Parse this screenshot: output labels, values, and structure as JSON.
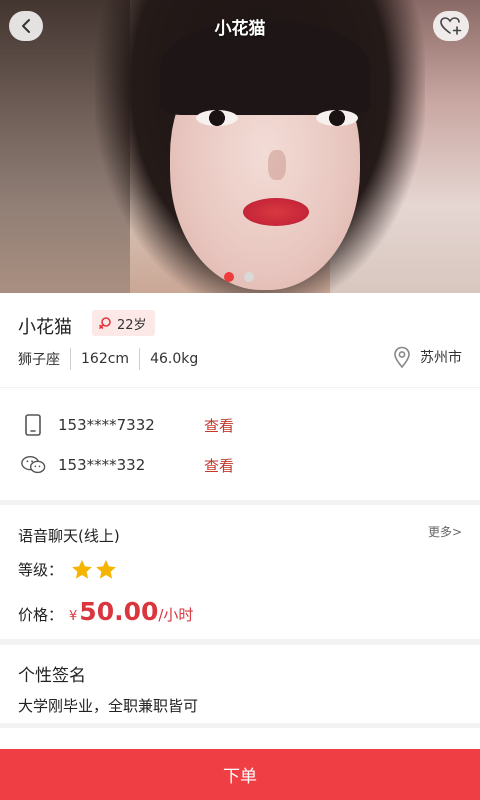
{
  "header": {
    "title": "小花猫"
  },
  "hero": {
    "photo_count": 2,
    "active_index": 0
  },
  "profile": {
    "name": "小花猫",
    "age": "22岁",
    "zodiac": "狮子座",
    "height": "162cm",
    "weight": "46.0kg",
    "city": "苏州市"
  },
  "contact": {
    "phone": "153****7332",
    "phone_view": "查看",
    "wechat": "153****332",
    "wechat_view": "查看"
  },
  "service": {
    "title": "语音聊天(线上)",
    "more": "更多>",
    "level_label": "等级：",
    "level_stars": 2,
    "price_label": "价格：",
    "currency": "¥",
    "price": "50.00",
    "unit": "/小时"
  },
  "signature": {
    "title": "个性签名",
    "text": "大学刚毕业，全职兼职皆可"
  },
  "footer": {
    "order_label": "下单"
  },
  "colors": {
    "accent": "#ef3f45",
    "price": "#d9363e",
    "star": "#f5b400"
  }
}
